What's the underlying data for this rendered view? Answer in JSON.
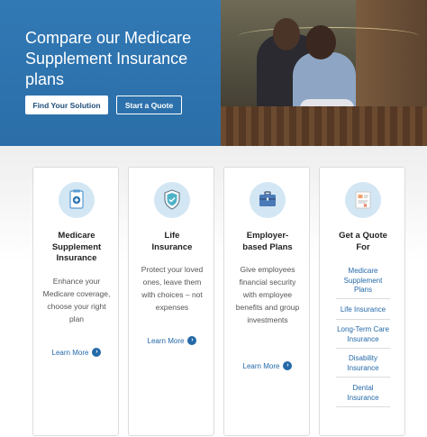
{
  "hero": {
    "title": "Compare our Medicare Supplement Insurance plans",
    "primary_button": "Find Your Solution",
    "secondary_button": "Start a Quote"
  },
  "cards": [
    {
      "title": "Medicare Supplement Insurance",
      "body": "Enhance your Medicare coverage, choose your right plan",
      "link": "Learn More",
      "icon": "clipboard-plus-icon"
    },
    {
      "title": "Life Insurance",
      "body": "Protect your loved ones, leave them with choices – not expenses",
      "link": "Learn More",
      "icon": "shield-check-icon"
    },
    {
      "title": "Employer-based Plans",
      "body": "Give employees financial security with employee benefits and group investments",
      "link": "Learn More",
      "icon": "briefcase-icon"
    },
    {
      "title": "Get a Quote For",
      "icon": "quote-form-icon",
      "links": [
        "Medicare Supplement Plans",
        "Life Insurance",
        "Long-Term Care Insurance",
        "Disability Insurance",
        "Dental Insurance"
      ]
    }
  ],
  "colors": {
    "brand_blue": "#2e74b0",
    "link_blue": "#2469a8",
    "icon_bg": "#d3e6f4"
  }
}
